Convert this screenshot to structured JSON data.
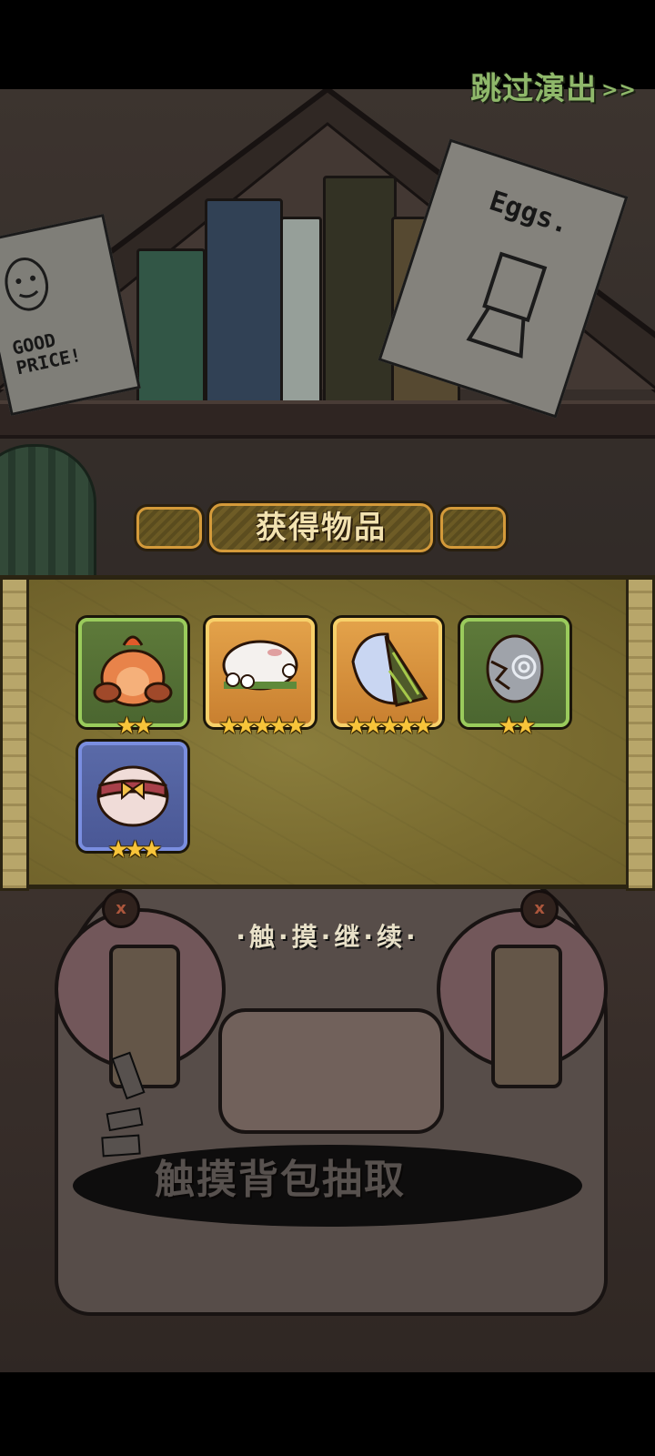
{
  "header": {
    "skip_label": "跳过演出",
    "skip_arrows": ">>"
  },
  "reward_panel": {
    "title": "获得物品",
    "items": [
      {
        "name": "orange-creature-item",
        "rarity": "green",
        "stars": "★★",
        "star_count": 2
      },
      {
        "name": "white-flower-nest-item",
        "rarity": "orange",
        "stars": "★★★★★",
        "star_count": 5
      },
      {
        "name": "crystal-wing-item",
        "rarity": "orange",
        "stars": "★★★★★",
        "star_count": 5
      },
      {
        "name": "cracked-egg-item",
        "rarity": "green",
        "stars": "★★",
        "star_count": 2
      },
      {
        "name": "bow-dumpling-item",
        "rarity": "blue",
        "stars": "★★★",
        "star_count": 3
      }
    ]
  },
  "continue_prompt": "·触·摸·继·续·",
  "background": {
    "draw_hint": "触摸背包抽取",
    "poster_left": "GOOD PRICE!",
    "poster_right": "Eggs."
  },
  "colors": {
    "skip_text": "#8fb86a",
    "panel_bg": "#7a6c30",
    "star": "#f7c43a",
    "rarity_green": "#9acb5c",
    "rarity_orange": "#f7d06a",
    "rarity_blue": "#7a8ee0"
  }
}
